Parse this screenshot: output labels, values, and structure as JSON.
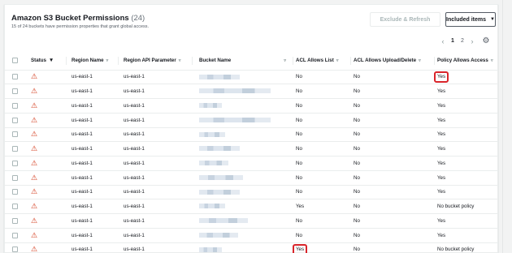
{
  "header": {
    "title": "Amazon S3 Bucket Permissions",
    "count": "(24)",
    "subtitle": "15 of 24 buckets have permission properties that grant global access."
  },
  "actions": {
    "exclude_refresh": "Exclude & Refresh",
    "included_items": "Included items"
  },
  "pagination": {
    "pages": [
      "1",
      "2"
    ]
  },
  "columns": {
    "status": "Status",
    "region_name": "Region Name",
    "region_api": "Region API Parameter",
    "bucket_name": "Bucket Name",
    "acl_list": "ACL Allows List",
    "acl_upload": "ACL Allows Upload/Delete",
    "policy_access": "Policy Allows Access"
  },
  "rows": [
    {
      "region_name": "us-east-1",
      "region_api": "us-east-1",
      "acl_list": "No",
      "acl_upload": "No",
      "policy_access": "Yes"
    },
    {
      "region_name": "us-east-1",
      "region_api": "us-east-1",
      "acl_list": "No",
      "acl_upload": "No",
      "policy_access": "Yes"
    },
    {
      "region_name": "us-east-1",
      "region_api": "us-east-1",
      "acl_list": "No",
      "acl_upload": "No",
      "policy_access": "Yes"
    },
    {
      "region_name": "us-east-1",
      "region_api": "us-east-1",
      "acl_list": "No",
      "acl_upload": "No",
      "policy_access": "Yes"
    },
    {
      "region_name": "us-east-1",
      "region_api": "us-east-1",
      "acl_list": "No",
      "acl_upload": "No",
      "policy_access": "Yes"
    },
    {
      "region_name": "us-east-1",
      "region_api": "us-east-1",
      "acl_list": "No",
      "acl_upload": "No",
      "policy_access": "Yes"
    },
    {
      "region_name": "us-east-1",
      "region_api": "us-east-1",
      "acl_list": "No",
      "acl_upload": "No",
      "policy_access": "Yes"
    },
    {
      "region_name": "us-east-1",
      "region_api": "us-east-1",
      "acl_list": "No",
      "acl_upload": "No",
      "policy_access": "Yes"
    },
    {
      "region_name": "us-east-1",
      "region_api": "us-east-1",
      "acl_list": "No",
      "acl_upload": "No",
      "policy_access": "Yes"
    },
    {
      "region_name": "us-east-1",
      "region_api": "us-east-1",
      "acl_list": "Yes",
      "acl_upload": "No",
      "policy_access": "No bucket policy"
    },
    {
      "region_name": "us-east-1",
      "region_api": "us-east-1",
      "acl_list": "No",
      "acl_upload": "No",
      "policy_access": "Yes"
    },
    {
      "region_name": "us-east-1",
      "region_api": "us-east-1",
      "acl_list": "No",
      "acl_upload": "No",
      "policy_access": "Yes"
    },
    {
      "region_name": "us-east-1",
      "region_api": "us-east-1",
      "acl_list": "Yes",
      "acl_upload": "No",
      "policy_access": "No bucket policy"
    }
  ],
  "icons": {
    "status": "warning-icon",
    "sort": "sort-icon",
    "settings": "gear-icon"
  },
  "colors": {
    "warning": "#d13212",
    "highlight": "#d9252b"
  }
}
